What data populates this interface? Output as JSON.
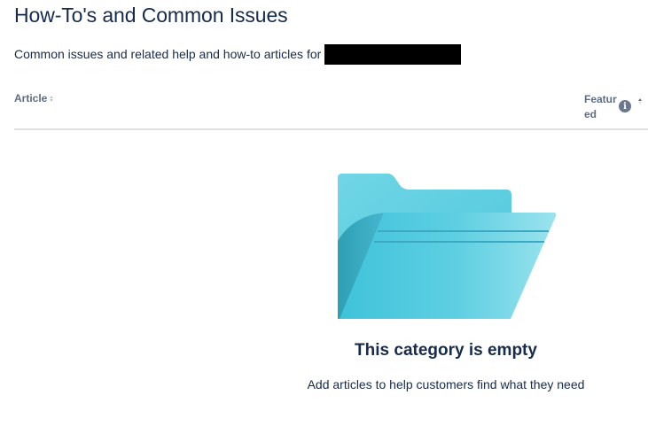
{
  "page": {
    "title": "How-To's and Common Issues",
    "subtitle": "Common issues and related help and how-to articles for"
  },
  "table": {
    "columns": [
      {
        "label": "Article",
        "sortable": true
      },
      {
        "label": "Featured",
        "sortable": true,
        "sort_direction": "ascending",
        "has_info_icon": true
      }
    ]
  },
  "empty_state": {
    "title": "This category is empty",
    "description": "Add articles to help customers find what they need",
    "illustration": "open-folder-icon"
  },
  "colors": {
    "heading": "#172b4d",
    "muted": "#5e6c84",
    "border": "#dfe1e6",
    "folder_back": "#5ccfe0",
    "folder_front": "#79dbe7"
  }
}
